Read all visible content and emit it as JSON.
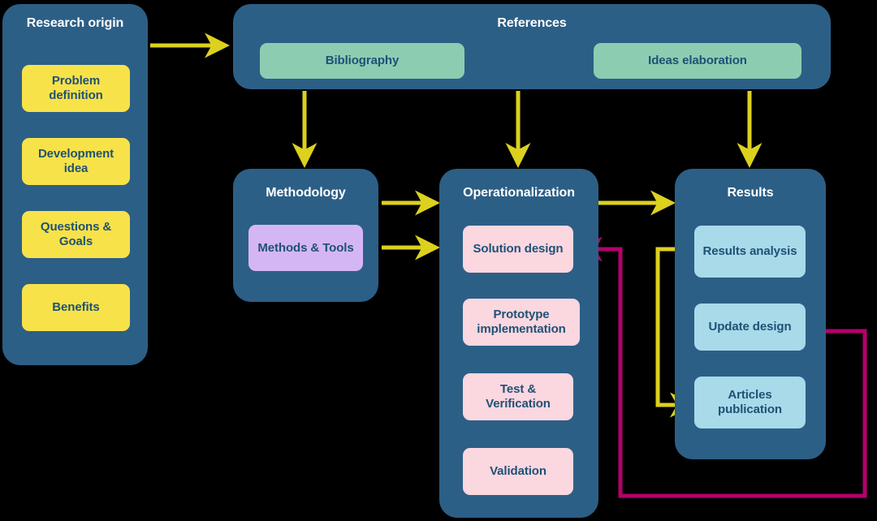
{
  "diagram": {
    "title": "Research process flow diagram",
    "colors": {
      "background": "#000000",
      "panel": "#2C5F86",
      "panel_title_text": "#FFFFFF",
      "node_text": "#1F5175",
      "arrow_yellow": "#DCD11E",
      "arrow_magenta": "#B5006B",
      "yellow_node": "#F7E249",
      "mint_node": "#8CCDB2",
      "purple_node": "#D5B6F5",
      "pink_node": "#FBD7E0",
      "blue_node": "#A8DAEA"
    }
  },
  "panels": {
    "research_origin": {
      "title": "Research origin",
      "nodes": [
        {
          "label": "Problem definition"
        },
        {
          "label": "Development idea"
        },
        {
          "label": "Questions & Goals"
        },
        {
          "label": "Benefits"
        }
      ]
    },
    "references": {
      "title": "References",
      "nodes": [
        {
          "label": "Bibliography"
        },
        {
          "label": "Ideas elaboration"
        }
      ]
    },
    "methodology": {
      "title": "Methodology",
      "nodes": [
        {
          "label": "Methods & Tools"
        }
      ]
    },
    "operationalization": {
      "title": "Operationalization",
      "nodes": [
        {
          "label": "Solution design"
        },
        {
          "label": "Prototype implementation"
        },
        {
          "label": "Test & Verification"
        },
        {
          "label": "Validation"
        }
      ]
    },
    "results": {
      "title": "Results",
      "nodes": [
        {
          "label": "Results analysis"
        },
        {
          "label": "Update design"
        },
        {
          "label": "Articles publication"
        }
      ]
    }
  },
  "connectors": [
    {
      "name": "research-origin-to-references",
      "color": "#DCD11E",
      "from": "Research origin",
      "to": "References"
    },
    {
      "name": "bibliography-to-ideas-elaboration",
      "color": "#DCD11E",
      "from": "Bibliography",
      "to": "Ideas elaboration"
    },
    {
      "name": "ideas-elaboration-to-bibliography",
      "color": "#DCD11E",
      "from": "Ideas elaboration",
      "to": "Bibliography"
    },
    {
      "name": "references-to-methodology",
      "color": "#DCD11E",
      "from": "References",
      "to": "Methodology"
    },
    {
      "name": "references-to-operationalization",
      "color": "#DCD11E",
      "from": "References",
      "to": "Operationalization"
    },
    {
      "name": "references-to-results",
      "color": "#DCD11E",
      "from": "References",
      "to": "Results"
    },
    {
      "name": "problem-definition-to-development-idea",
      "color": "#DCD11E",
      "from": "Problem definition",
      "to": "Development idea"
    },
    {
      "name": "development-idea-to-questions-goals",
      "color": "#DCD11E",
      "from": "Development idea",
      "to": "Questions & Goals"
    },
    {
      "name": "questions-goals-to-benefits",
      "color": "#DCD11E",
      "from": "Questions & Goals",
      "to": "Benefits"
    },
    {
      "name": "methodology-to-operationalization-top",
      "color": "#DCD11E",
      "from": "Methodology",
      "to": "Operationalization"
    },
    {
      "name": "methods-tools-to-solution-design",
      "color": "#DCD11E",
      "from": "Methods & Tools",
      "to": "Solution design"
    },
    {
      "name": "solution-design-to-prototype",
      "color": "#DCD11E",
      "from": "Solution design",
      "to": "Prototype implementation"
    },
    {
      "name": "prototype-to-test-verification",
      "color": "#DCD11E",
      "from": "Prototype implementation",
      "to": "Test & Verification"
    },
    {
      "name": "test-verification-to-validation",
      "color": "#DCD11E",
      "from": "Test & Verification",
      "to": "Validation"
    },
    {
      "name": "operationalization-to-results",
      "color": "#DCD11E",
      "from": "Operationalization",
      "to": "Results"
    },
    {
      "name": "results-analysis-to-update-design",
      "color": "#DCD11E",
      "from": "Results analysis",
      "to": "Update design"
    },
    {
      "name": "results-analysis-to-articles-publication",
      "color": "#DCD11E",
      "from": "Results analysis",
      "to": "Articles publication"
    },
    {
      "name": "update-design-to-solution-design",
      "color": "#B5006B",
      "from": "Update design",
      "to": "Solution design"
    }
  ]
}
